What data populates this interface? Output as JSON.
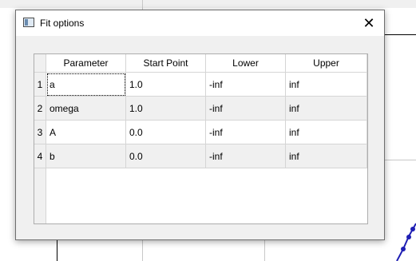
{
  "dialog": {
    "title": "Fit options",
    "close_glyph": "✕",
    "icon": "window-icon"
  },
  "table": {
    "columns": [
      "Parameter",
      "Start Point",
      "Lower",
      "Upper"
    ],
    "rows": [
      {
        "num": "1",
        "cells": [
          "a",
          "1.0",
          "-inf",
          "inf"
        ]
      },
      {
        "num": "2",
        "cells": [
          "omega",
          "1.0",
          "-inf",
          "inf"
        ]
      },
      {
        "num": "3",
        "cells": [
          "A",
          "0.0",
          "-inf",
          "inf"
        ]
      },
      {
        "num": "4",
        "cells": [
          "b",
          "0.0",
          "-inf",
          "inf"
        ]
      }
    ]
  },
  "colors": {
    "curve": "#1f1fb4"
  }
}
